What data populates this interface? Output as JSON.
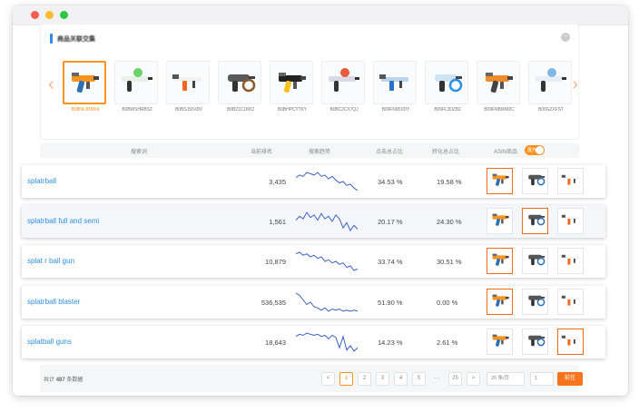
{
  "window": {
    "controls": [
      {
        "name": "close",
        "color": "#f25f57"
      },
      {
        "name": "minimize",
        "color": "#f8bc2e"
      },
      {
        "name": "zoom",
        "color": "#2bc840"
      }
    ]
  },
  "panel": {
    "title": "商品关联交集",
    "products": [
      {
        "code": "B08NLJDMX4",
        "selected": true,
        "icon": "orange-gun-icon"
      },
      {
        "code": "B0BWSHRBS2",
        "selected": false,
        "icon": "green-blaster-icon"
      },
      {
        "code": "B0BSJS5X8V",
        "selected": false,
        "icon": "orange-white-gun-icon"
      },
      {
        "code": "B0B21C1KK2",
        "selected": false,
        "icon": "rifle-icon"
      },
      {
        "code": "B0BHPCYTKY",
        "selected": false,
        "icon": "yellow-black-gun-icon"
      },
      {
        "code": "B0BC2CX7QJ",
        "selected": false,
        "icon": "red-blaster-icon"
      },
      {
        "code": "B09FN95XDY",
        "selected": false,
        "icon": "blue-blaster-icon"
      },
      {
        "code": "B09FL3DZB2",
        "selected": false,
        "icon": "splash-blaster-icon"
      },
      {
        "code": "B09FNBWM2C",
        "selected": false,
        "icon": "orange-smg-icon"
      },
      {
        "code": "B09GZXFST",
        "selected": false,
        "icon": "white-blaster-icon"
      }
    ]
  },
  "table": {
    "headers": {
      "keyword": "搜索词",
      "rank": "当前排名",
      "trend": "搜索趋势",
      "click_share": "点击总占比",
      "conversion_share": "转化总占比",
      "asin_label": "ASIN商品",
      "toggle_label": "展开"
    },
    "rows": [
      {
        "keyword": "splatrball",
        "rank": "3,435",
        "click_share": "34.53 %",
        "conversion_share": "19.58 %",
        "trend": [
          14,
          12,
          13,
          10,
          11,
          12,
          10,
          13,
          12,
          15,
          13,
          16,
          18,
          17,
          20,
          19,
          22,
          24
        ],
        "asins": [
          true,
          false,
          false
        ]
      },
      {
        "keyword": "splatrball full and semi",
        "rank": "1,561",
        "click_share": "20.17 %",
        "conversion_share": "24.30 %",
        "trend": [
          16,
          13,
          15,
          10,
          14,
          12,
          16,
          11,
          15,
          13,
          17,
          12,
          15,
          22,
          18,
          24,
          20,
          23
        ],
        "asins": [
          false,
          true,
          false
        ]
      },
      {
        "keyword": "splat r ball gun",
        "rank": "10,879",
        "click_share": "33.74 %",
        "conversion_share": "30.51 %",
        "trend": [
          12,
          11,
          13,
          12,
          14,
          13,
          15,
          14,
          17,
          16,
          18,
          17,
          19,
          18,
          21,
          20,
          23,
          22
        ],
        "asins": [
          true,
          false,
          false
        ]
      },
      {
        "keyword": "splatrball blaster",
        "rank": "536,535",
        "click_share": "51.90 %",
        "conversion_share": "0.00 %",
        "trend": [
          8,
          10,
          14,
          18,
          16,
          20,
          21,
          23,
          21,
          24,
          22,
          23,
          22,
          24,
          23,
          24,
          23,
          24
        ],
        "asins": [
          true,
          false,
          false
        ]
      },
      {
        "keyword": "splatball guns",
        "rank": "18,643",
        "click_share": "14.23 %",
        "conversion_share": "2.61 %",
        "trend": [
          12,
          10,
          11,
          9,
          10,
          11,
          10,
          12,
          11,
          14,
          11,
          13,
          22,
          12,
          24,
          20,
          25,
          22
        ],
        "asins": [
          false,
          false,
          true
        ]
      }
    ]
  },
  "footer": {
    "total_prefix": "共计",
    "total_count": "487",
    "total_suffix": "条数据",
    "pages": [
      "<",
      "1",
      "2",
      "3",
      "4",
      "5",
      "…",
      "25",
      ">"
    ],
    "active_page": "1",
    "page_size": "20 条/页",
    "goto_value": "1",
    "go_label": "前往"
  },
  "colors": {
    "accent": "#f7931e",
    "link": "#2f8fe6",
    "trend_line": "#3a5fc0"
  }
}
